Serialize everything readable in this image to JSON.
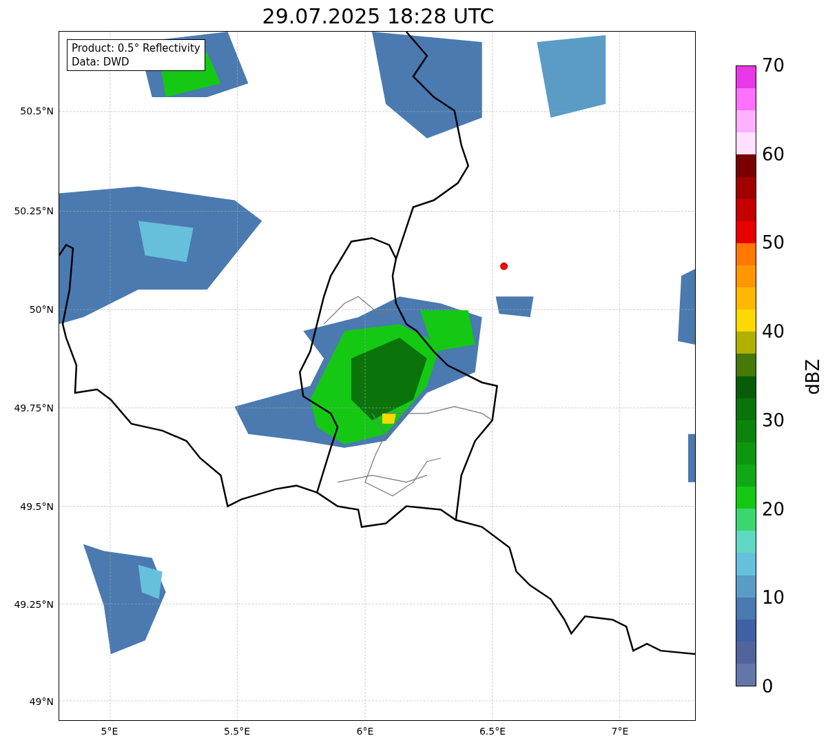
{
  "title": "29.07.2025 18:28 UTC",
  "info_box": [
    "Product: 0.5° Reflectivity",
    "Data: DWD"
  ],
  "y_ticks": [
    "50.5°N",
    "50.25°N",
    "50°N",
    "49.75°N",
    "49.5°N",
    "49.25°N",
    "49°N"
  ],
  "x_ticks": [
    "5°E",
    "5.5°E",
    "6°E",
    "6.5°E",
    "7°E"
  ],
  "colorbar": {
    "label": "dBZ",
    "ticks": [
      "70",
      "60",
      "50",
      "40",
      "30",
      "20",
      "10",
      "0"
    ],
    "segments": [
      {
        "color": "#e838e8"
      },
      {
        "color": "#ff70ff"
      },
      {
        "color": "#ffb0ff"
      },
      {
        "color": "#ffe0ff"
      },
      {
        "color": "#780000"
      },
      {
        "color": "#a00000"
      },
      {
        "color": "#c40000"
      },
      {
        "color": "#e80000"
      },
      {
        "color": "#ff7800"
      },
      {
        "color": "#ff9800"
      },
      {
        "color": "#ffb800"
      },
      {
        "color": "#ffd800"
      },
      {
        "color": "#b0b000"
      },
      {
        "color": "#487808"
      },
      {
        "color": "#085c08"
      },
      {
        "color": "#0a740a"
      },
      {
        "color": "#0c840c"
      },
      {
        "color": "#0e9610"
      },
      {
        "color": "#10a814"
      },
      {
        "color": "#14c814"
      },
      {
        "color": "#3cd670"
      },
      {
        "color": "#60d8c4"
      },
      {
        "color": "#66c0dc"
      },
      {
        "color": "#5a9cc6"
      },
      {
        "color": "#4a7ab0"
      },
      {
        "color": "#4060a4"
      },
      {
        "color": "#50649c"
      },
      {
        "color": "#6476a8"
      }
    ]
  }
}
